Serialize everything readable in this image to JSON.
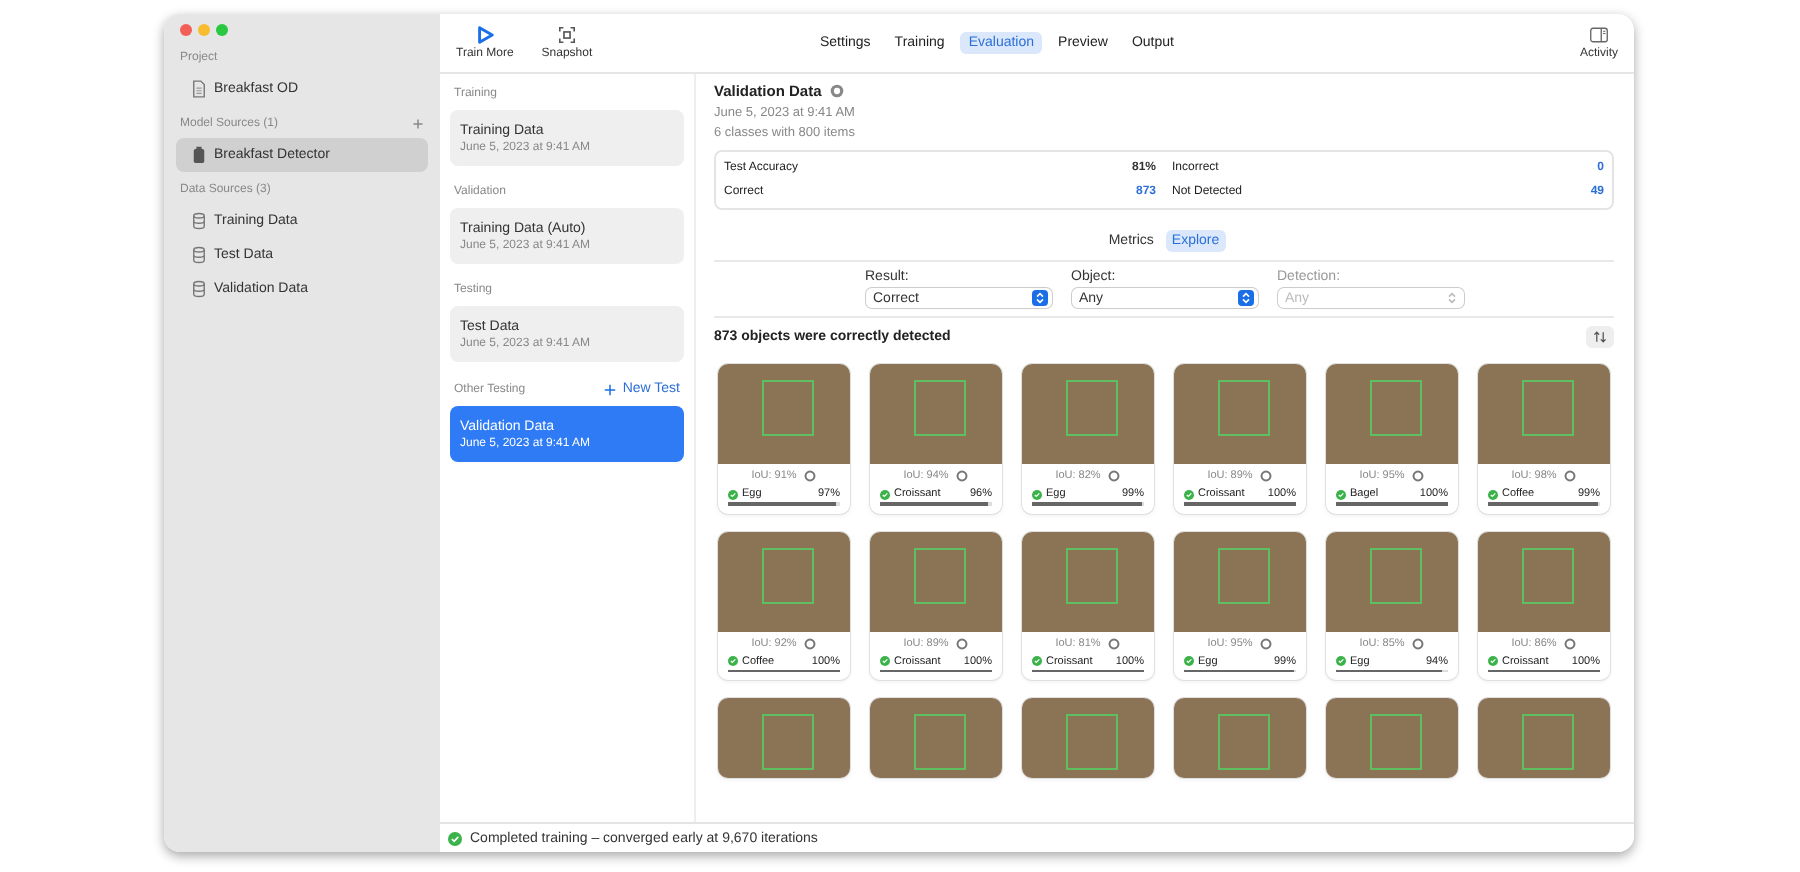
{
  "toolbar": {
    "buttons": [
      {
        "kind": "play",
        "label": "Train More"
      },
      {
        "kind": "snapshot",
        "label": "Snapshot"
      }
    ],
    "tabs": [
      {
        "label": "Settings",
        "selected": false
      },
      {
        "label": "Training",
        "selected": false
      },
      {
        "label": "Evaluation",
        "selected": true
      },
      {
        "label": "Preview",
        "selected": false
      },
      {
        "label": "Output",
        "selected": false
      }
    ],
    "activity": {
      "label": "Activity"
    }
  },
  "sidebar": {
    "sections": [
      {
        "title": "Project",
        "add": false,
        "items": [
          {
            "kind": "document",
            "label": "Breakfast OD",
            "selected": false
          }
        ]
      },
      {
        "title": "Model Sources (1)",
        "add": true,
        "items": [
          {
            "kind": "model",
            "label": "Breakfast Detector",
            "selected": true
          }
        ]
      },
      {
        "title": "Data Sources (3)",
        "add": false,
        "items": [
          {
            "kind": "database",
            "label": "Training Data",
            "selected": false
          },
          {
            "kind": "database",
            "label": "Test Data",
            "selected": false
          },
          {
            "kind": "database",
            "label": "Validation Data",
            "selected": false
          }
        ]
      }
    ]
  },
  "datasets": {
    "groups": [
      {
        "title": "Training",
        "items": [
          {
            "name": "Training Data",
            "date": "June 5, 2023 at 9:41 AM",
            "selected": false
          }
        ]
      },
      {
        "title": "Validation",
        "items": [
          {
            "name": "Training Data (Auto)",
            "date": "June 5, 2023 at 9:41 AM",
            "selected": false
          }
        ]
      },
      {
        "title": "Testing",
        "items": [
          {
            "name": "Test Data",
            "date": "June 5, 2023 at 9:41 AM",
            "selected": false
          }
        ]
      },
      {
        "title": "Other Testing",
        "action": "New Test",
        "items": [
          {
            "name": "Validation Data",
            "date": "June 5, 2023 at 9:41 AM",
            "selected": true
          }
        ]
      }
    ]
  },
  "detail": {
    "title": "Validation Data",
    "date": "June 5, 2023 at 9:41 AM",
    "summary": "6 classes with 800 items",
    "stats": [
      {
        "label": "Test Accuracy",
        "value": "81%",
        "link": false
      },
      {
        "label": "Incorrect",
        "value": "0",
        "link": true
      },
      {
        "label": "Correct",
        "value": "873",
        "link": true
      },
      {
        "label": "Not Detected",
        "value": "49",
        "link": true
      }
    ],
    "modes": [
      {
        "label": "Metrics",
        "selected": false
      },
      {
        "label": "Explore",
        "selected": true
      }
    ],
    "filters": [
      {
        "label": "Result:",
        "value": "Correct",
        "disabled": false
      },
      {
        "label": "Object:",
        "value": "Any",
        "disabled": false
      },
      {
        "label": "Detection:",
        "value": "Any",
        "disabled": true
      }
    ],
    "results_heading": "873 objects were correctly detected",
    "cards": [
      {
        "kind": "full",
        "iou": "IoU: 91%",
        "label": "Egg",
        "confidence": "97%",
        "level": 0.97
      },
      {
        "kind": "full",
        "iou": "IoU: 94%",
        "label": "Croissant",
        "confidence": "96%",
        "level": 0.96
      },
      {
        "kind": "full",
        "iou": "IoU: 82%",
        "label": "Egg",
        "confidence": "99%",
        "level": 0.99
      },
      {
        "kind": "full",
        "iou": "IoU: 89%",
        "label": "Croissant",
        "confidence": "100%",
        "level": 1
      },
      {
        "kind": "full",
        "iou": "IoU: 95%",
        "label": "Bagel",
        "confidence": "100%",
        "level": 1
      },
      {
        "kind": "full",
        "iou": "IoU: 98%",
        "label": "Coffee",
        "confidence": "99%",
        "level": 0.99
      },
      {
        "kind": "full",
        "iou": "IoU: 92%",
        "label": "Coffee",
        "confidence": "100%",
        "level": 1
      },
      {
        "kind": "full",
        "iou": "IoU: 89%",
        "label": "Croissant",
        "confidence": "100%",
        "level": 1
      },
      {
        "kind": "full",
        "iou": "IoU: 81%",
        "label": "Croissant",
        "confidence": "100%",
        "level": 1
      },
      {
        "kind": "full",
        "iou": "IoU: 95%",
        "label": "Egg",
        "confidence": "99%",
        "level": 0.99
      },
      {
        "kind": "full",
        "iou": "IoU: 85%",
        "label": "Egg",
        "confidence": "94%",
        "level": 0.94
      },
      {
        "kind": "full",
        "iou": "IoU: 86%",
        "label": "Croissant",
        "confidence": "100%",
        "level": 1
      },
      {
        "kind": "photo_only"
      },
      {
        "kind": "photo_only"
      },
      {
        "kind": "photo_only"
      },
      {
        "kind": "photo_only"
      },
      {
        "kind": "photo_only"
      },
      {
        "kind": "photo_only"
      }
    ]
  },
  "status_bar": {
    "text": "Completed training – converged early at 9,670 iterations"
  }
}
